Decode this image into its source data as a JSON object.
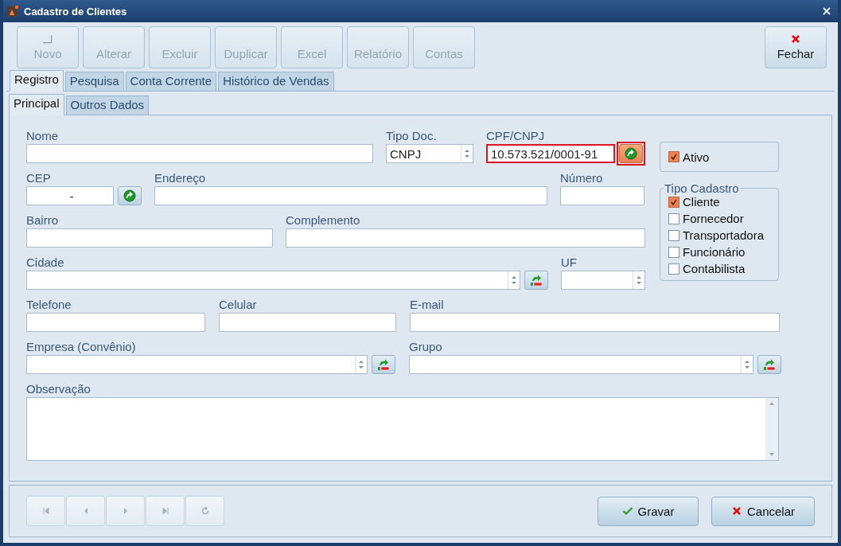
{
  "window": {
    "title": "Cadastro de Clientes"
  },
  "toolbar": [
    {
      "label": "Novo",
      "kind": "new",
      "disabled": true
    },
    {
      "label": "Alterar",
      "kind": "plain",
      "disabled": true
    },
    {
      "label": "Excluir",
      "kind": "plain",
      "disabled": true
    },
    {
      "label": "Duplicar",
      "kind": "plain",
      "disabled": true
    },
    {
      "label": "Excel",
      "kind": "plain",
      "disabled": true
    },
    {
      "label": "Relatório",
      "kind": "plain",
      "disabled": true
    },
    {
      "label": "Contas",
      "kind": "plain",
      "disabled": true
    }
  ],
  "close_button": {
    "label": "Fechar",
    "disabled": false
  },
  "tabs": [
    {
      "label": "Registro",
      "selected": true
    },
    {
      "label": "Pesquisa",
      "selected": false
    },
    {
      "label": "Conta Corrente",
      "selected": false
    },
    {
      "label": "Histórico de Vendas",
      "selected": false
    }
  ],
  "subtabs": [
    {
      "label": "Principal",
      "selected": true
    },
    {
      "label": "Outros Dados",
      "selected": false
    }
  ],
  "form": {
    "fields": [
      {
        "label": "Nome",
        "kind": "text"
      },
      {
        "label": "Tipo Doc.",
        "kind": "combo",
        "value": "CNPJ"
      },
      {
        "label": "CPF/CNPJ",
        "kind": "text",
        "value": "10.573.521/0001-91",
        "button": {
          "kind": "go"
        },
        "highlighted": true
      },
      {
        "label": "CEP",
        "kind": "text",
        "value": "-",
        "button": {
          "kind": "go"
        }
      },
      {
        "label": "Endereço",
        "kind": "text"
      },
      {
        "label": "Número",
        "kind": "text"
      },
      {
        "label": "Bairro",
        "kind": "text"
      },
      {
        "label": "Complemento",
        "kind": "text"
      },
      {
        "label": "Cidade",
        "kind": "combo",
        "button": {
          "kind": "lookup"
        }
      },
      {
        "label": "UF",
        "kind": "combo"
      },
      {
        "label": "Telefone",
        "kind": "text"
      },
      {
        "label": "Celular",
        "kind": "text"
      },
      {
        "label": "E-mail",
        "kind": "text"
      },
      {
        "label": "Empresa (Convênio)",
        "kind": "combo",
        "button": {
          "kind": "lookup"
        }
      },
      {
        "label": "Grupo",
        "kind": "combo",
        "button": {
          "kind": "lookup"
        }
      },
      {
        "label": "Observação",
        "kind": "textarea"
      }
    ],
    "ativo": {
      "label": "Ativo",
      "checked": true
    },
    "tipo_cadastro": {
      "title": "Tipo Cadastro",
      "options": [
        {
          "label": "Cliente",
          "checked": true
        },
        {
          "label": "Fornecedor",
          "checked": false
        },
        {
          "label": "Transportadora",
          "checked": false
        },
        {
          "label": "Funcionário",
          "checked": false
        },
        {
          "label": "Contabilista",
          "checked": false
        }
      ]
    }
  },
  "navigation": [
    {
      "kind": "first",
      "disabled": true
    },
    {
      "kind": "prev",
      "disabled": true
    },
    {
      "kind": "next",
      "disabled": true
    },
    {
      "kind": "last",
      "disabled": true
    },
    {
      "kind": "refresh",
      "disabled": true
    }
  ],
  "actions": [
    {
      "label": "Gravar",
      "kind": "save"
    },
    {
      "label": "Cancelar",
      "kind": "cancel"
    }
  ]
}
